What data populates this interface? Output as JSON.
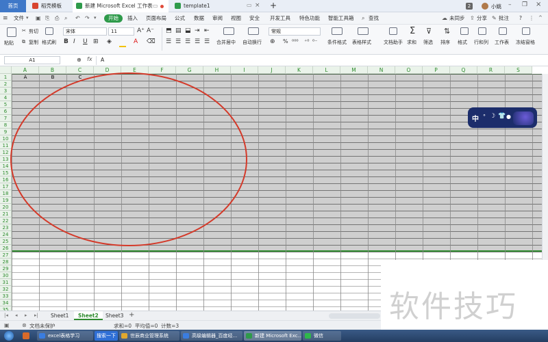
{
  "tabs": {
    "home": "首页",
    "t1": "稻壳模板",
    "t2": "新建 Microsoft Excel 工作表",
    "t3": "template1",
    "plus": "+",
    "badge": "2",
    "user": "小姚"
  },
  "menu": {
    "file": "文件",
    "start": "开始",
    "items": [
      "插入",
      "页面布局",
      "公式",
      "数据",
      "审阅",
      "视图",
      "安全",
      "开发工具",
      "特色功能",
      "智能工具箱"
    ],
    "search": "查找",
    "sync": "未同步",
    "share": "分享",
    "comment": "批注",
    "help": "?"
  },
  "toolbar": {
    "paste": "粘贴",
    "cut": "剪切",
    "copy": "复制",
    "format_painter": "格式刷",
    "font": "宋体",
    "size": "11",
    "bold": "B",
    "italic": "I",
    "underline": "U",
    "merge": "合并居中",
    "wrap": "自动换行",
    "numfmt": "常规",
    "cond": "条件格式",
    "tablestyle": "表格样式",
    "docassist": "文档助手",
    "sum": "求和",
    "filter": "筛选",
    "sort": "排序",
    "format": "格式",
    "rowcol": "行和列",
    "sheet": "工作表",
    "freeze": "冻结窗格",
    "sigma": "Σ"
  },
  "formula": {
    "namebox": "A1",
    "fx": "fx",
    "value": "A"
  },
  "grid": {
    "columns": [
      "A",
      "B",
      "C",
      "D",
      "E",
      "F",
      "G",
      "H",
      "I",
      "J",
      "K",
      "L",
      "M",
      "N",
      "O",
      "P",
      "Q",
      "R",
      "S"
    ],
    "rows": [
      "1",
      "2",
      "3",
      "4",
      "5",
      "6",
      "7",
      "8",
      "9",
      "10",
      "11",
      "12",
      "13",
      "14",
      "15",
      "16",
      "17",
      "18",
      "19",
      "20",
      "21",
      "22",
      "23",
      "24",
      "25",
      "26",
      "27",
      "28",
      "29",
      "30",
      "31",
      "32",
      "33",
      "34",
      "35"
    ],
    "cells": {
      "A1": "A",
      "B1": "B",
      "C1": "C"
    }
  },
  "sheets": [
    "Sheet1",
    "Sheet2",
    "Sheet3"
  ],
  "status": {
    "protect": "文档未保护",
    "stats": "求和=0  平均值=0  计数=3"
  },
  "taskbar": {
    "items": [
      "excel表格学习",
      "搜索一下",
      "世辰商业管理系统",
      "高级编辑器_百度经...",
      "新建 Microsoft Exc...",
      "微信"
    ]
  },
  "float": {
    "cn": "中"
  },
  "watermark": "软件技巧",
  "colors": {
    "accent": "#2e8b2e",
    "ellipse": "#d43a2a",
    "selection": "#cfcfcf"
  }
}
